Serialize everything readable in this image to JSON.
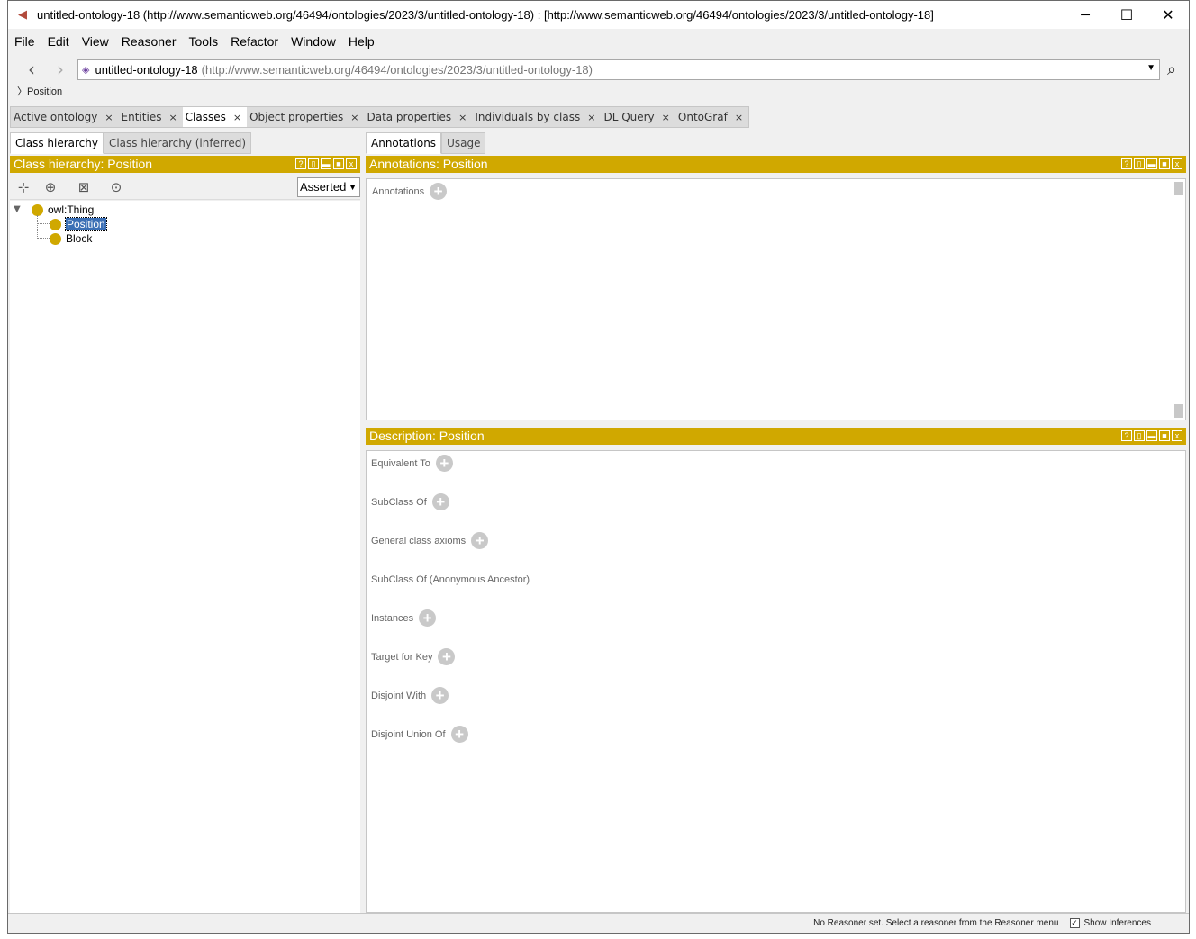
{
  "window": {
    "title": "untitled-ontology-18 (http://www.semanticweb.org/46494/ontologies/2023/3/untitled-ontology-18)  : [http://www.semanticweb.org/46494/ontologies/2023/3/untitled-ontology-18]",
    "minimize": "─",
    "maximize": "☐",
    "close": "✕"
  },
  "menu": [
    "File",
    "Edit",
    "View",
    "Reasoner",
    "Tools",
    "Refactor",
    "Window",
    "Help"
  ],
  "nav": {
    "back": "‹",
    "forward": "›",
    "ontology_name": "untitled-ontology-18",
    "ontology_iri": "(http://www.semanticweb.org/46494/ontologies/2023/3/untitled-ontology-18)",
    "breadcrumb": "Position"
  },
  "tabs": [
    {
      "label": "Active ontology",
      "close": "×"
    },
    {
      "label": "Entities",
      "close": "×"
    },
    {
      "label": "Classes",
      "close": "×"
    },
    {
      "label": "Object properties",
      "close": "×"
    },
    {
      "label": "Data properties",
      "close": "×"
    },
    {
      "label": "Individuals by class",
      "close": "×"
    },
    {
      "label": "DL Query",
      "close": "×"
    },
    {
      "label": "OntoGraf",
      "close": "×"
    }
  ],
  "left": {
    "subtabs": [
      "Class hierarchy",
      "Class hierarchy (inferred)"
    ],
    "title": "Class hierarchy: Position",
    "select_value": "Asserted",
    "tree": {
      "root": "owl:Thing",
      "children": [
        "Position",
        "Block"
      ]
    }
  },
  "right": {
    "subtabs": [
      "Annotations",
      "Usage"
    ],
    "annotations_title": "Annotations: Position",
    "annotations_label": "Annotations",
    "description_title": "Description: Position",
    "sections": [
      {
        "label": "Equivalent To",
        "addable": true
      },
      {
        "label": "SubClass Of",
        "addable": true
      },
      {
        "label": "General class axioms",
        "addable": true
      },
      {
        "label": "SubClass Of (Anonymous Ancestor)",
        "addable": false
      },
      {
        "label": "Instances",
        "addable": true
      },
      {
        "label": "Target for Key",
        "addable": true
      },
      {
        "label": "Disjoint With",
        "addable": true
      },
      {
        "label": "Disjoint Union Of",
        "addable": true
      }
    ]
  },
  "status": {
    "reasoner_message": "No Reasoner set. Select a reasoner from the Reasoner menu",
    "show_inferences": "Show Inferences"
  },
  "colors": {
    "accent": "#d0a800",
    "selection": "#3b6fb5"
  }
}
